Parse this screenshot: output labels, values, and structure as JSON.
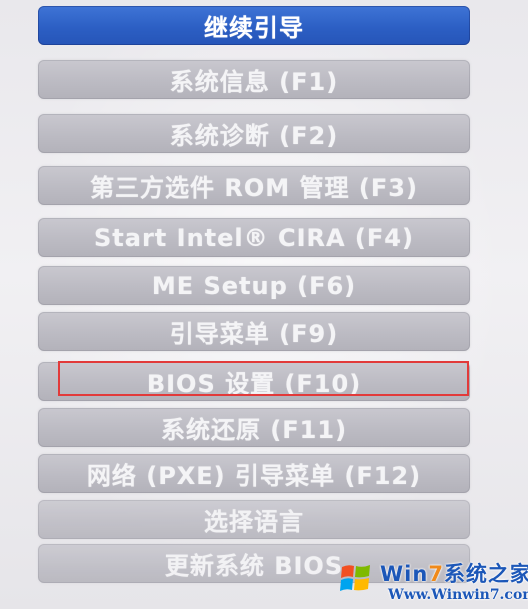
{
  "menu": {
    "items": [
      {
        "label": "继续引导"
      },
      {
        "label": "系统信息 (F1)"
      },
      {
        "label": "系统诊断 (F2)"
      },
      {
        "label": "第三方选件 ROM 管理 (F3)"
      },
      {
        "label": "Start Intel® CIRA (F4)"
      },
      {
        "label": "ME Setup (F6)"
      },
      {
        "label": "引导菜单 (F9)"
      },
      {
        "label": "BIOS 设置 (F10)"
      },
      {
        "label": "系统还原 (F11)"
      },
      {
        "label": "网络 (PXE) 引导菜单 (F12)"
      },
      {
        "label": "选择语言"
      },
      {
        "label": "更新系统 BIOS"
      }
    ],
    "selected_index": 0,
    "highlighted_index": 7
  },
  "watermark": {
    "brand_prefix": "Win",
    "brand_seven": "7",
    "brand_suffix": "系统之家",
    "url": "Www.Winwin7.com"
  },
  "colors": {
    "selected_item": "#2c5fc4",
    "normal_item": "#bcbbc3",
    "highlight_border": "#e23a3a",
    "watermark_text": "#1c57b8",
    "watermark_seven": "#f08a1a"
  }
}
